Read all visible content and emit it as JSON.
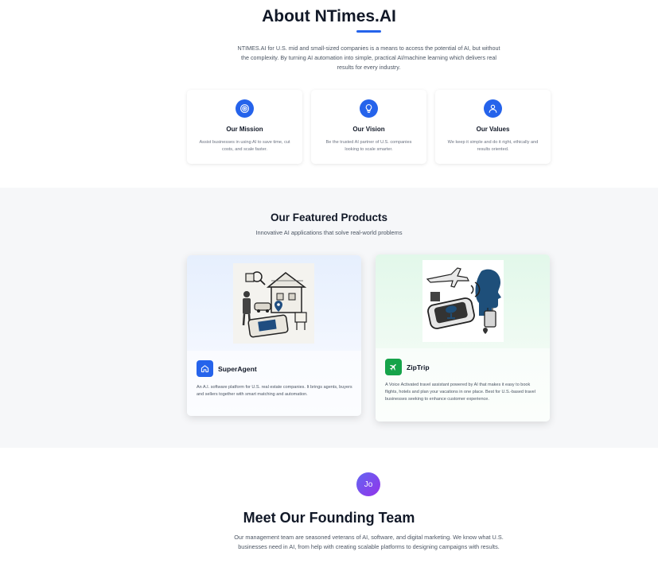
{
  "about": {
    "title": "About NTimes.AI",
    "description": "NTIMES.AI for U.S. mid and small-sized companies is a means to access the potential of AI, but without the complexity. By turning AI automation into simple, practical AI/machine learning which delivers real results for every industry.",
    "cards": [
      {
        "icon": "target-icon",
        "title": "Our Mission",
        "text": "Assist businesses in using AI to save time, cut costs, and scale faster."
      },
      {
        "icon": "lightbulb-icon",
        "title": "Our Vision",
        "text": "Be the trusted AI partner of U.S. companies looking to scale smarter."
      },
      {
        "icon": "user-icon",
        "title": "Our Values",
        "text": "We keep it simple and do it right, ethically and results oriented."
      }
    ]
  },
  "products": {
    "title": "Our Featured Products",
    "subtitle": "Innovative AI applications that solve real-world problems",
    "items": [
      {
        "icon": "home-icon",
        "name": "SuperAgent",
        "description": "An A.I. software platform for U.S. real estate companies. It brings agents, buyers and sellers together with smart matching and automation.",
        "color": "#2563eb"
      },
      {
        "icon": "plane-icon",
        "name": "ZipTrip",
        "description": "A Voice Activated travel assistant powered by AI that makes it easy to book flights, hotels and plan your vacations in one place. Best for U.S.-based travel businesses seeking to enhance customer experience.",
        "color": "#16a34a"
      }
    ]
  },
  "team": {
    "avatar_initials": "Jo",
    "title": "Meet Our Founding Team",
    "description": "Our management team are seasoned veterans of AI, software, and digital marketing. We know what U.S. businesses need in AI, from help with creating scalable platforms to designing campaigns with results."
  },
  "colors": {
    "accent": "#2563eb",
    "green": "#16a34a",
    "section_bg": "#f6f7f9"
  }
}
